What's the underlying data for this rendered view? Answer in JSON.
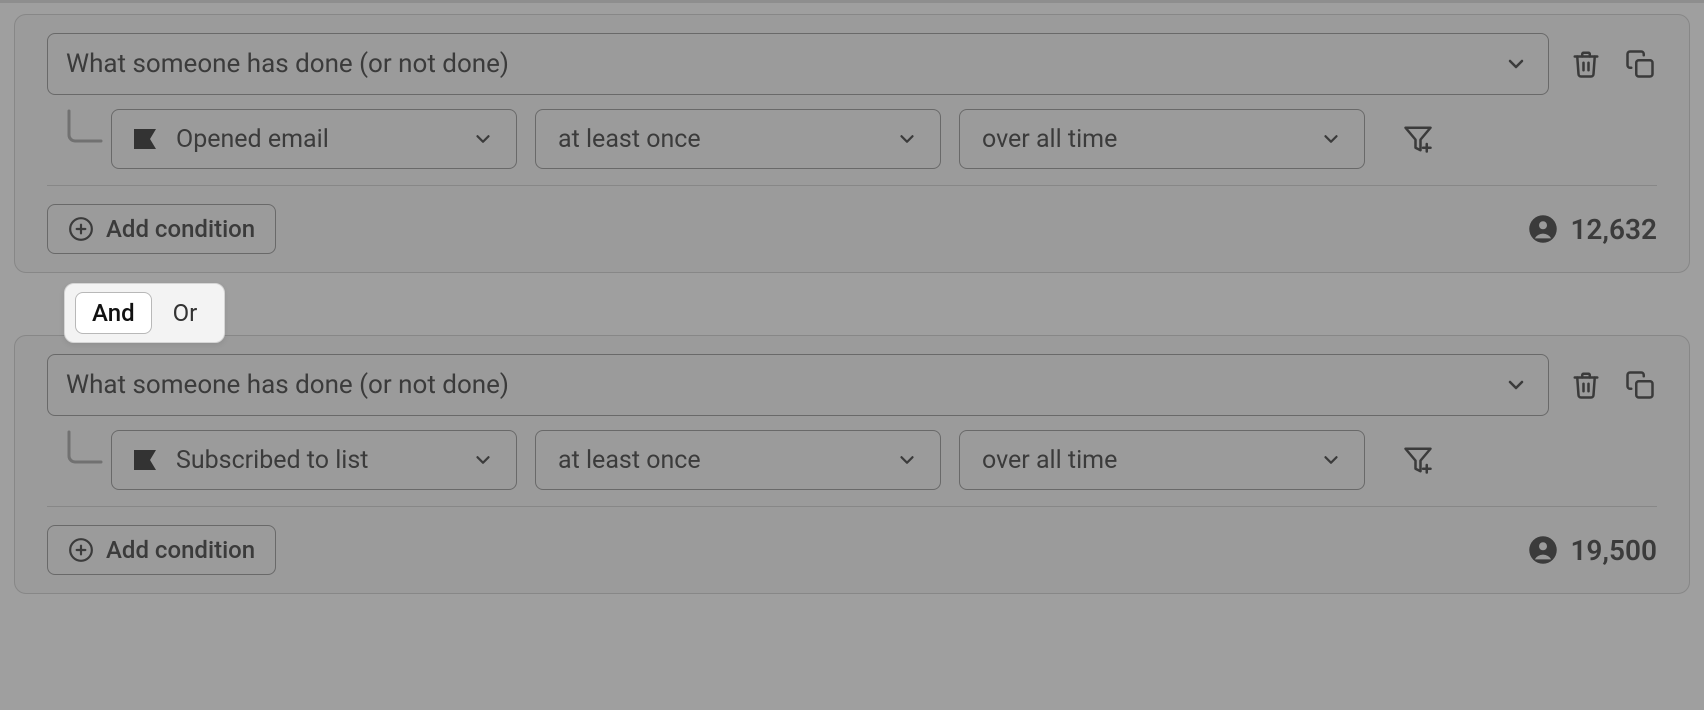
{
  "groups": [
    {
      "main_label": "What someone has done (or not done)",
      "event_label": "Opened email",
      "freq_label": "at least once",
      "time_label": "over all time",
      "add_condition_label": "Add condition",
      "count": "12,632"
    },
    {
      "main_label": "What someone has done (or not done)",
      "event_label": "Subscribed to list",
      "freq_label": "at least once",
      "time_label": "over all time",
      "add_condition_label": "Add condition",
      "count": "19,500"
    }
  ],
  "logic": {
    "and_label": "And",
    "or_label": "Or",
    "active": "And"
  }
}
